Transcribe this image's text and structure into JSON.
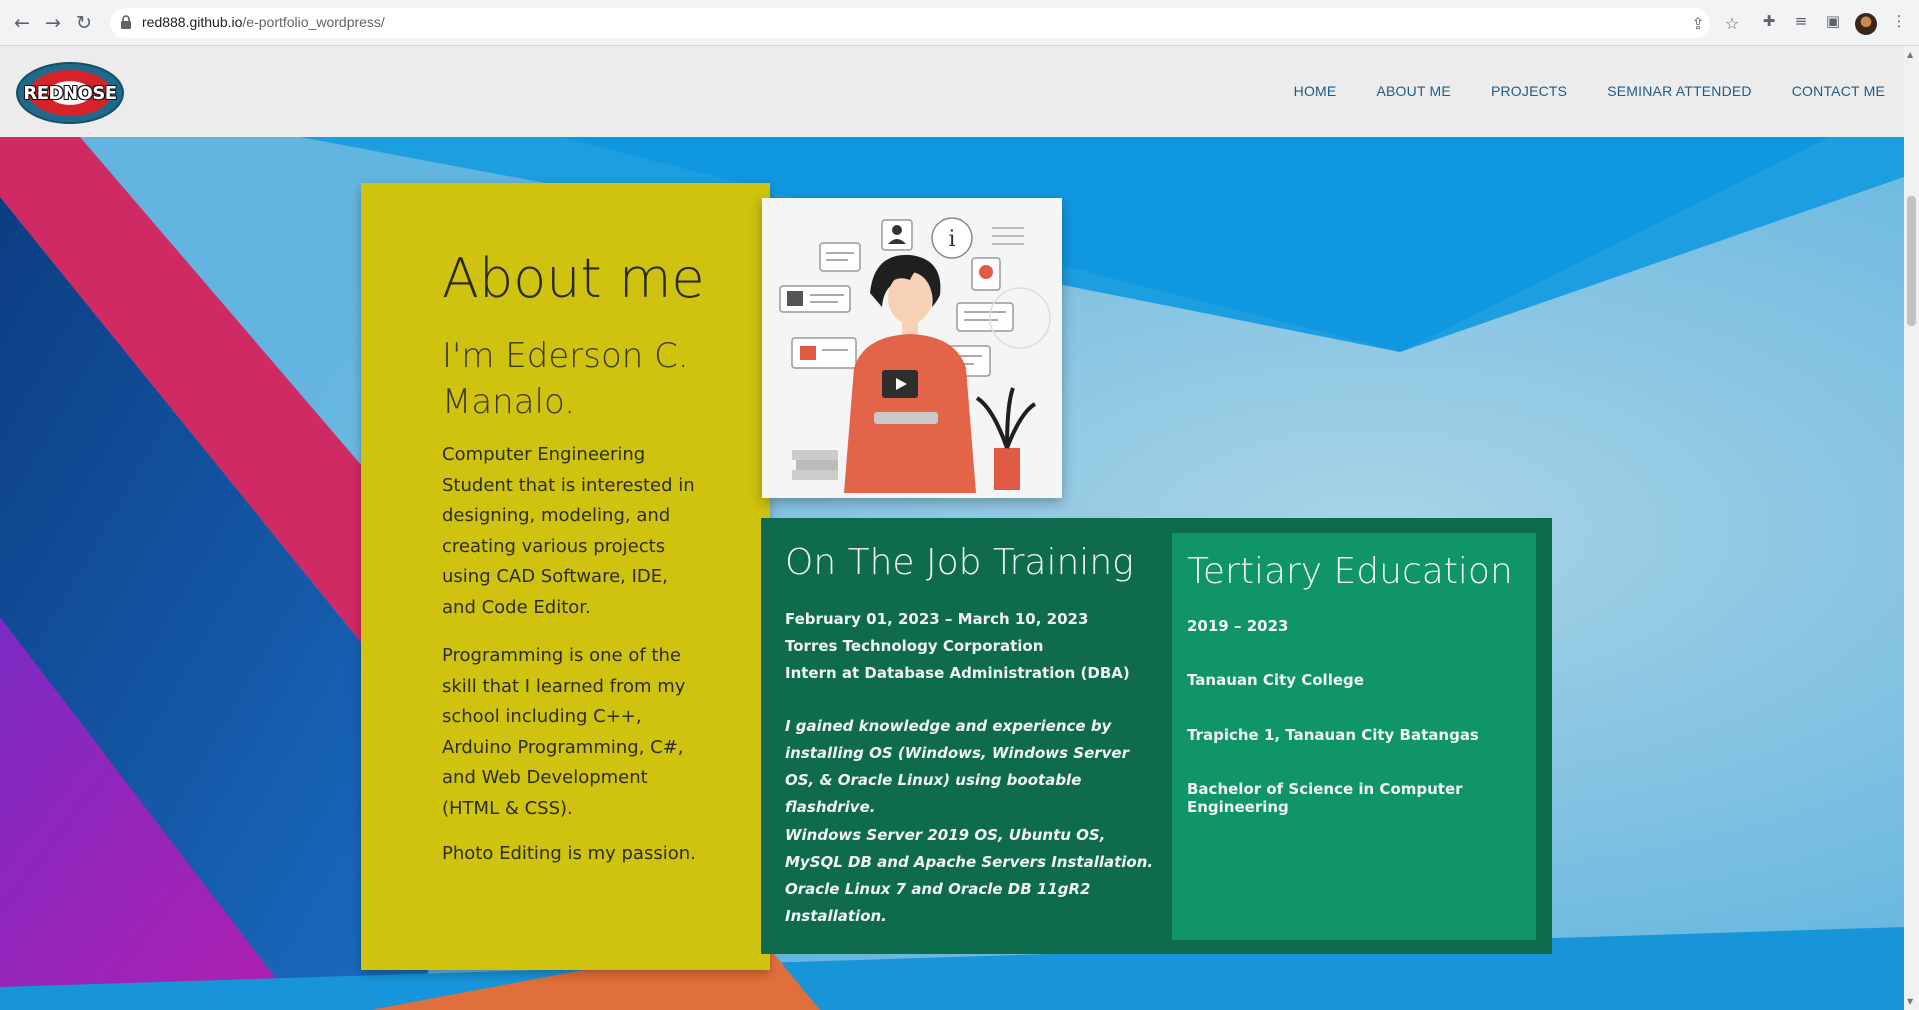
{
  "browser": {
    "url_host": "red888.github.io",
    "url_path": "/e-portfolio_wordpress/"
  },
  "site": {
    "logo_text": "REDNOSE",
    "nav": [
      "HOME",
      "ABOUT ME",
      "PROJECTS",
      "SEMINAR ATTENDED",
      "CONTACT ME"
    ]
  },
  "about": {
    "title": "About me",
    "name": "I'm Ederson C. Manalo.",
    "paragraph1": "Computer Engineering Student that is interested in designing, modeling, and creating various projects using CAD Software, IDE, and Code Editor.",
    "paragraph2": "Programming is one of the skill that I learned from my school including C++, Arduino Programming, C#, and Web Development (HTML & CSS).",
    "paragraph3": "Photo Editing is my passion."
  },
  "ojt": {
    "title": "On The Job Training",
    "dates": "February 01, 2023 – March 10, 2023",
    "company": "Torres Technology Corporation",
    "role": "Intern at Database Administration (DBA)",
    "desc1": "I gained knowledge and experience by installing OS (Windows, Windows Server OS, & Oracle Linux) using bootable flashdrive.",
    "desc2": "Windows Server 2019 OS, Ubuntu OS, MySQL DB and Apache Servers Installation.",
    "desc3": "Oracle Linux 7 and Oracle DB 11gR2 Installation."
  },
  "education": {
    "title": "Tertiary Education",
    "years": "2019 – 2023",
    "school": "Tanauan City College",
    "address": "Trapiche 1, Tanauan City Batangas",
    "degree": "Bachelor of Science in Computer Engineering"
  },
  "icons": {
    "back": "back-arrow-icon",
    "forward": "forward-arrow-icon",
    "reload": "reload-icon",
    "lock": "lock-icon",
    "share": "share-icon",
    "bookmark": "star-icon",
    "extensions": "puzzle-icon",
    "reading_list": "reading-list-icon",
    "side_panel": "side-panel-icon",
    "menu": "kebab-menu-icon"
  },
  "colors": {
    "yellow_card": "#cfc30f",
    "green_panel": "#0f6b4e",
    "green_card": "#10946a",
    "nav_link": "#1d5c8c"
  }
}
